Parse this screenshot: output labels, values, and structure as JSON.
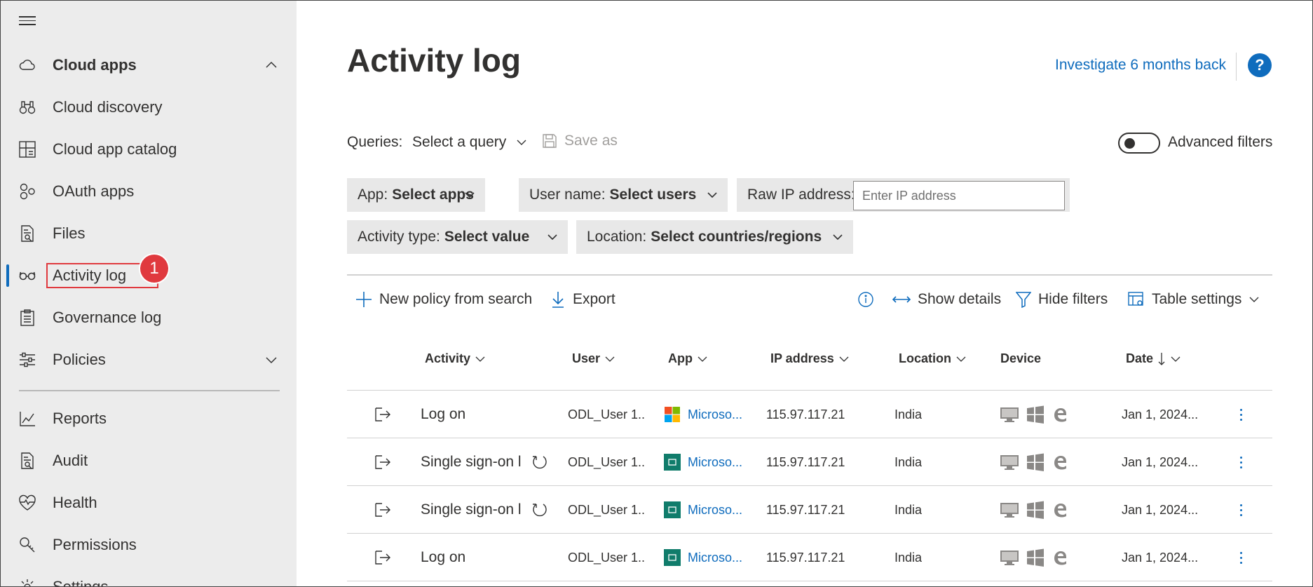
{
  "sidebar": {
    "items": [
      {
        "label": "Cloud apps",
        "icon": "cloud-icon"
      },
      {
        "label": "Cloud discovery",
        "icon": "binoculars-icon"
      },
      {
        "label": "Cloud app catalog",
        "icon": "catalog-icon"
      },
      {
        "label": "OAuth apps",
        "icon": "oauth-icon"
      },
      {
        "label": "Files",
        "icon": "file-search-icon"
      },
      {
        "label": "Activity log",
        "icon": "glasses-icon"
      },
      {
        "label": "Governance log",
        "icon": "clipboard-icon"
      },
      {
        "label": "Policies",
        "icon": "sliders-icon"
      },
      {
        "label": "Reports",
        "icon": "chart-line-icon"
      },
      {
        "label": "Audit",
        "icon": "document-search-icon"
      },
      {
        "label": "Health",
        "icon": "heart-pulse-icon"
      },
      {
        "label": "Permissions",
        "icon": "key-icon"
      },
      {
        "label": "Settings",
        "icon": "gear-icon"
      }
    ],
    "step_badge": "1"
  },
  "header": {
    "title": "Activity log",
    "investigate_link": "Investigate 6 months back",
    "help": "?"
  },
  "queries": {
    "label": "Queries:",
    "select": "Select a query",
    "save_as": "Save as",
    "advanced_filters": "Advanced filters",
    "advanced_filters_on": false
  },
  "filters": {
    "app": {
      "label": "App:",
      "value": "Select apps"
    },
    "user": {
      "label": "User name:",
      "value": "Select users"
    },
    "ip": {
      "label": "Raw IP address:",
      "placeholder": "Enter IP address"
    },
    "activity_type": {
      "label": "Activity type:",
      "value": "Select value"
    },
    "location": {
      "label": "Location:",
      "value": "Select countries/regions"
    }
  },
  "toolbar": {
    "new_policy": "New policy from search",
    "export": "Export",
    "show_details": "Show details",
    "hide_filters": "Hide filters",
    "table_settings": "Table settings"
  },
  "table": {
    "columns": {
      "activity": "Activity",
      "user": "User",
      "app": "App",
      "ip": "IP address",
      "location": "Location",
      "device": "Device",
      "date": "Date"
    },
    "rows": [
      {
        "activity": "Log on",
        "user": "ODL_User 1...",
        "app": "Microso...",
        "app_logo": "microsoft-logo",
        "ip": "115.97.117.21",
        "location": "India",
        "date": "Jan 1, 2024...",
        "refresh": false
      },
      {
        "activity": "Single sign-on l",
        "user": "ODL_User 1...",
        "app": "Microso...",
        "app_logo": "teams-green-logo",
        "ip": "115.97.117.21",
        "location": "India",
        "date": "Jan 1, 2024...",
        "refresh": true
      },
      {
        "activity": "Single sign-on l",
        "user": "ODL_User 1...",
        "app": "Microso...",
        "app_logo": "teams-green-logo",
        "ip": "115.97.117.21",
        "location": "India",
        "date": "Jan 1, 2024...",
        "refresh": true
      },
      {
        "activity": "Log on",
        "user": "ODL_User 1...",
        "app": "Microso...",
        "app_logo": "teams-green-logo",
        "ip": "115.97.117.21",
        "location": "India",
        "date": "Jan 1, 2024...",
        "refresh": false
      }
    ]
  },
  "colors": {
    "accent": "#0f6cbd",
    "highlight": "#e0393e",
    "sidebar_bg": "#ececec",
    "filter_bg": "#e8e8e8",
    "app_green": "#107c6b"
  }
}
